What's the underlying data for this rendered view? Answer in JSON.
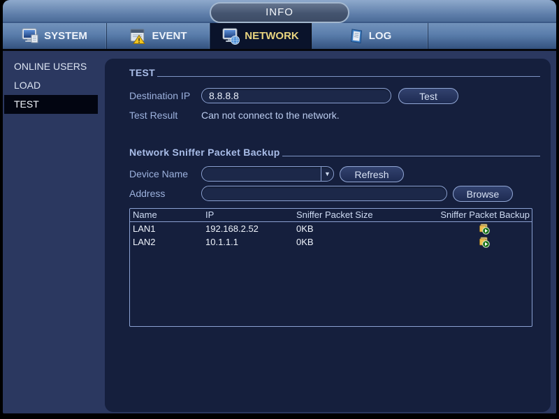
{
  "window": {
    "title": "INFO"
  },
  "tabs": [
    {
      "label": "SYSTEM",
      "active": false,
      "icon": "system-icon"
    },
    {
      "label": "EVENT",
      "active": false,
      "icon": "event-icon"
    },
    {
      "label": "NETWORK",
      "active": true,
      "icon": "network-icon"
    },
    {
      "label": "LOG",
      "active": false,
      "icon": "log-icon"
    }
  ],
  "sidebar": {
    "items": [
      {
        "label": "ONLINE USERS",
        "selected": false
      },
      {
        "label": "LOAD",
        "selected": false
      },
      {
        "label": "TEST",
        "selected": true
      }
    ]
  },
  "test_section": {
    "title": "TEST",
    "destination_ip": {
      "label": "Destination IP",
      "value": "8.8.8.8"
    },
    "test_button_label": "Test",
    "test_result": {
      "label": "Test Result",
      "value": "Can not connect to the network."
    }
  },
  "sniffer_section": {
    "title": "Network Sniffer Packet Backup",
    "device_name": {
      "label": "Device Name",
      "value": ""
    },
    "refresh_button_label": "Refresh",
    "address": {
      "label": "Address",
      "value": ""
    },
    "browse_button_label": "Browse",
    "table": {
      "columns": [
        "Name",
        "IP",
        "Sniffer Packet Size",
        "Sniffer Packet Backup"
      ],
      "rows": [
        {
          "name": "LAN1",
          "ip": "192.168.2.52",
          "packet_size": "0KB",
          "backup_icon": "sniffer-backup-icon"
        },
        {
          "name": "LAN2",
          "ip": "10.1.1.1",
          "packet_size": "0KB",
          "backup_icon": "sniffer-backup-icon"
        }
      ]
    }
  },
  "colors": {
    "active_tab_text": "#e9d47f",
    "tab_active_bg": "#0a132b",
    "sidebar_bg": "#2b3860",
    "panel_bg": "#151f3d",
    "accent_border": "#8ba1d2",
    "selected_item_bg": "#020511"
  }
}
